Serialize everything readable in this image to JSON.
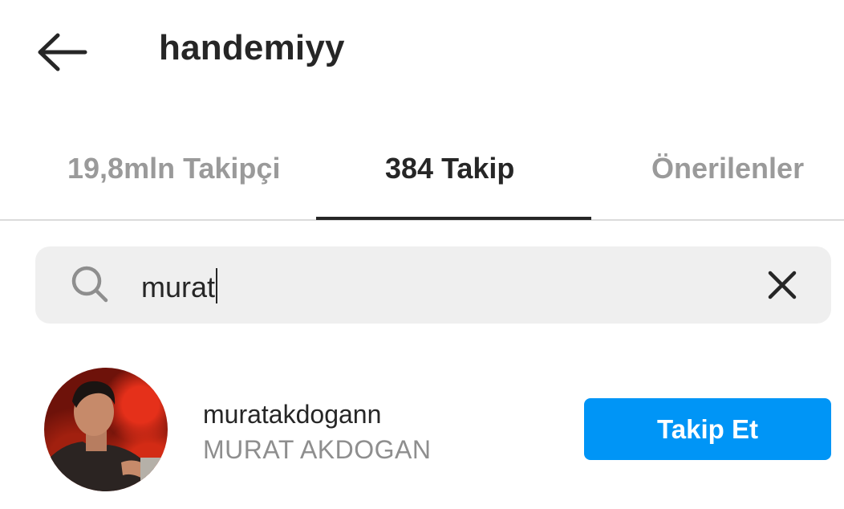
{
  "header": {
    "title": "handemiyy",
    "back_icon": "arrow-left-icon"
  },
  "tabs": [
    {
      "label": "19,8mln Takipçi",
      "active": false
    },
    {
      "label": "384 Takip",
      "active": true
    },
    {
      "label": "Önerilenler",
      "active": false
    }
  ],
  "search": {
    "value": "murat",
    "search_icon": "search-icon",
    "clear_icon": "close-icon"
  },
  "results": [
    {
      "username": "muratakdogann",
      "full_name": "MURAT AKDOGAN",
      "button_label": "Takip Et"
    }
  ],
  "colors": {
    "accent": "#0095f6",
    "text_primary": "#262626",
    "text_secondary": "#8e8e8e",
    "search_bg": "#efefef"
  }
}
